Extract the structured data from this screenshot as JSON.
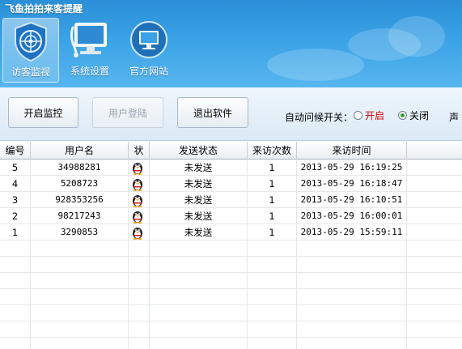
{
  "app": {
    "title": "飞鱼拍拍来客提醒"
  },
  "nav": {
    "items": [
      {
        "label": "访客监视",
        "icon": "radar-shield-icon",
        "active": true
      },
      {
        "label": "系统设置",
        "icon": "monitor-settings-icon",
        "active": false
      },
      {
        "label": "官方网站",
        "icon": "monitor-website-icon",
        "active": false
      }
    ]
  },
  "toolbar": {
    "start_label": "开启监控",
    "login_label": "用户登陆",
    "exit_label": "退出软件",
    "auto_greet_label": "自动问候开关：",
    "opt_on": "开启",
    "opt_off": "关闭",
    "selected": "关闭",
    "extra_label": "声"
  },
  "table": {
    "columns": [
      "编号",
      "用户名",
      "状",
      "发送状态",
      "来访次数",
      "来访时间"
    ],
    "rows": [
      {
        "id": "5",
        "user": "34988281",
        "status": "未发送",
        "visits": "1",
        "time": "2013-05-29 16:19:25"
      },
      {
        "id": "4",
        "user": "5208723",
        "status": "未发送",
        "visits": "1",
        "time": "2013-05-29 16:18:47"
      },
      {
        "id": "3",
        "user": "928353256",
        "status": "未发送",
        "visits": "1",
        "time": "2013-05-29 16:10:51"
      },
      {
        "id": "2",
        "user": "98217243",
        "status": "未发送",
        "visits": "1",
        "time": "2013-05-29 16:00:01"
      },
      {
        "id": "1",
        "user": "3290853",
        "status": "未发送",
        "visits": "1",
        "time": "2013-05-29 15:59:11"
      }
    ]
  },
  "colors": {
    "accent": "#3aa2e6",
    "on_text": "#d40000",
    "radio_selected": "#2e9a2e"
  }
}
